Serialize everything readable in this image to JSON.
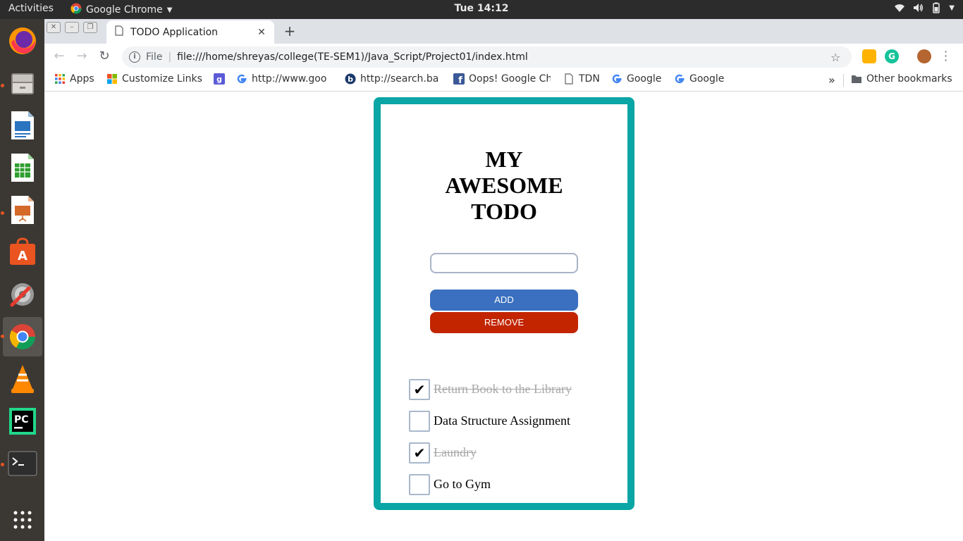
{
  "topbar": {
    "activities": "Activities",
    "app_name": "Google Chrome",
    "clock": "Tue 14:12"
  },
  "dock": {
    "items": [
      "firefox-icon",
      "files-icon",
      "writer-icon",
      "calc-icon",
      "impress-icon",
      "software-center-icon",
      "settings-icon",
      "chrome-icon",
      "vlc-icon",
      "pycharm-icon",
      "terminal-icon",
      "show-apps-icon"
    ]
  },
  "browser": {
    "tab_title": "TODO Application",
    "scheme_label": "File",
    "url": "file:///home/shreyas/college(TE-SEM1)/Java_Script/Project01/index.html",
    "bookmarks": [
      {
        "label": "Apps",
        "icon": "apps-grid-icon"
      },
      {
        "label": "Customize Links",
        "icon": "windows-icon"
      },
      {
        "label": "",
        "icon": "g-square-icon"
      },
      {
        "label": "http://www.goo",
        "icon": "google-g-icon"
      },
      {
        "label": "http://search.ba",
        "icon": "b-circle-icon"
      },
      {
        "label": "Oops! Google Ch",
        "icon": "facebook-icon"
      },
      {
        "label": "TDN",
        "icon": "page-icon"
      },
      {
        "label": "Google",
        "icon": "google-g-icon"
      },
      {
        "label": "Google",
        "icon": "google-g-icon"
      }
    ],
    "overflow": "»",
    "other_bookmarks": "Other bookmarks"
  },
  "todo": {
    "title_lines": [
      "MY",
      "AWESOME",
      "TODO"
    ],
    "input_value": "",
    "add_label": "ADD",
    "remove_label": "REMOVE",
    "items": [
      {
        "text": "Return Book to the Library",
        "done": true
      },
      {
        "text": "Data Structure Assignment",
        "done": false
      },
      {
        "text": "Laundry",
        "done": true
      },
      {
        "text": "Go to Gym",
        "done": false
      }
    ],
    "check_mark": "✔"
  },
  "colors": {
    "card_border": "#0aa5a5",
    "add_button": "#3a70bf",
    "remove_button": "#c22500"
  }
}
